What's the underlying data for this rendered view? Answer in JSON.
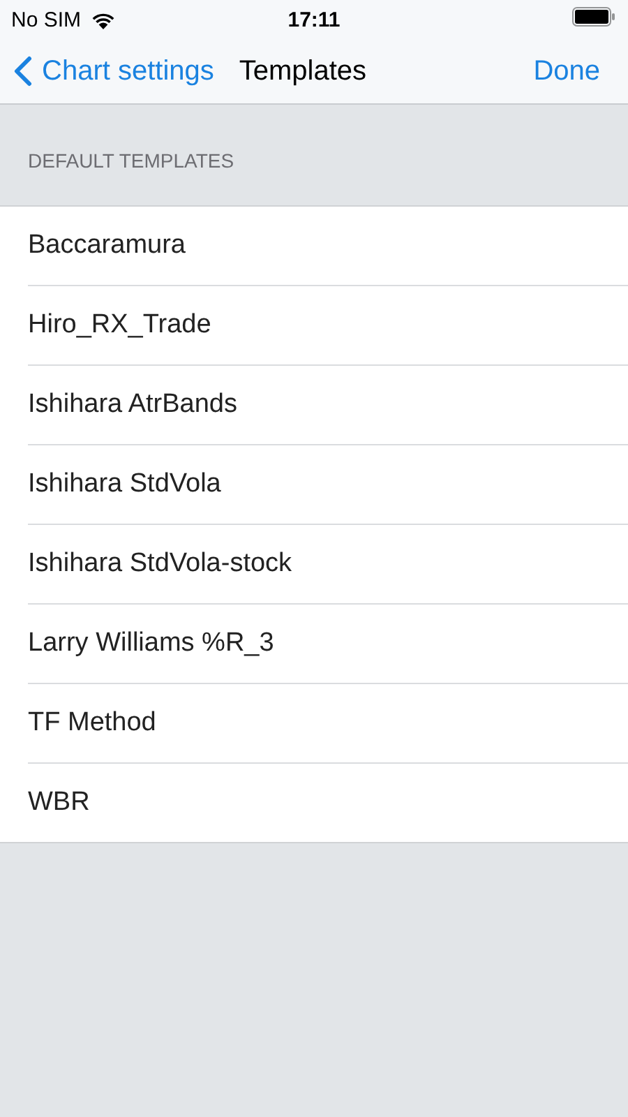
{
  "status_bar": {
    "carrier": "No SIM",
    "time": "17:11"
  },
  "nav": {
    "back": "Chart settings",
    "title": "Templates",
    "done": "Done"
  },
  "section": {
    "header": "DEFAULT TEMPLATES",
    "items": [
      "Baccaramura",
      "Hiro_RX_Trade",
      "Ishihara AtrBands",
      "Ishihara StdVola",
      "Ishihara StdVola-stock",
      "Larry Williams %R_3",
      "TF Method",
      "WBR"
    ]
  }
}
